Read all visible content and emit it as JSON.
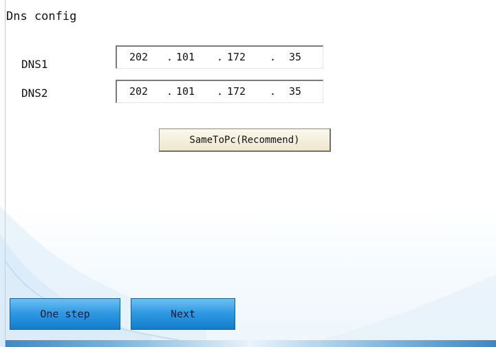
{
  "title": "Dns config",
  "dns1": {
    "label": "DNS1",
    "octets": [
      "202",
      "101",
      "172",
      "35"
    ]
  },
  "dns2": {
    "label": "DNS2",
    "octets": [
      "202",
      "101",
      "172",
      "35"
    ]
  },
  "ip_separator": ".",
  "buttons": {
    "same_to_pc": "SameToPc(Recommend)",
    "one_step": "One step",
    "next": "Next"
  },
  "colors": {
    "nav_button": "#2e98e2",
    "accent_bar": "#3f89c3"
  }
}
